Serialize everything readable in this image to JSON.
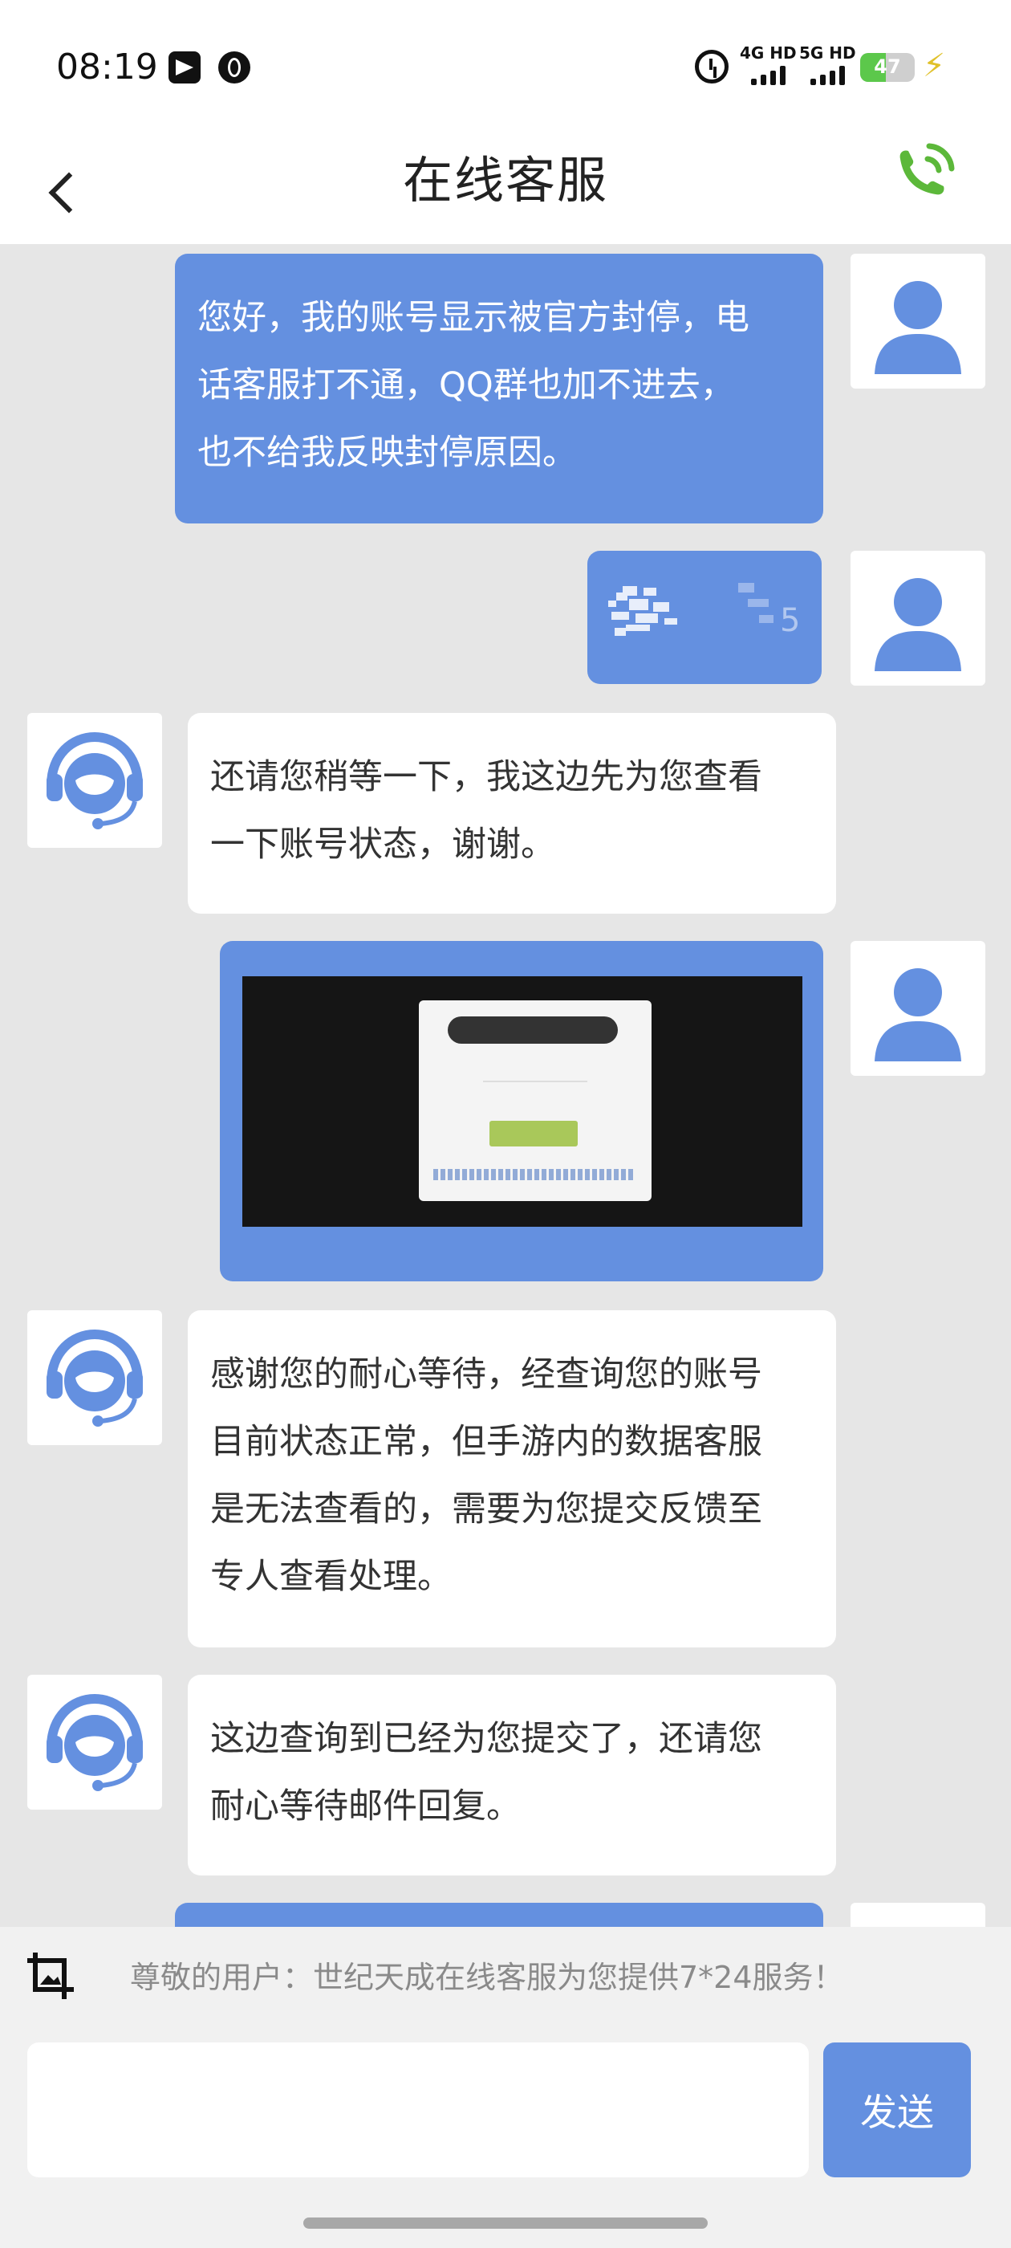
{
  "status_bar": {
    "time": "08:19",
    "net1": "4G HD",
    "net2": "5G HD",
    "battery": "47",
    "battery_color": "#5cc84b"
  },
  "header": {
    "title": "在线客服",
    "back_icon": "chevron-left-icon",
    "call_icon": "phone-call-icon",
    "call_icon_color": "#5cb83a"
  },
  "messages": [
    {
      "sender": "user",
      "type": "text",
      "lines": [
        "您好，我的账号显示被官方封停，电",
        "话客服打不通，QQ群也加不进去，",
        "也不给我反映封停原因。"
      ]
    },
    {
      "sender": "user",
      "type": "image-blurred"
    },
    {
      "sender": "agent",
      "type": "text",
      "lines": [
        "还请您稍等一下，我这边先为您查看",
        "一下账号状态，谢谢。"
      ]
    },
    {
      "sender": "user",
      "type": "image-screenshot"
    },
    {
      "sender": "agent",
      "type": "text",
      "lines": [
        "感谢您的耐心等待，经查询您的账号",
        "目前状态正常，但手游内的数据客服",
        "是无法查看的，需要为您提交反馈至",
        "专人查看处理。"
      ]
    },
    {
      "sender": "agent",
      "type": "text",
      "lines": [
        "这边查询到已经为您提交了，还请您",
        "耐心等待邮件回复。"
      ]
    }
  ],
  "footer": {
    "notice": "尊敬的用户：世纪天成在线客服为您提供7*24服务！",
    "input_value": "",
    "send_label": "发送",
    "crop_icon": "crop-icon"
  },
  "colors": {
    "user_bubble": "#6490e0",
    "agent_bubble": "#ffffff",
    "chat_bg": "#e6e6e6"
  }
}
